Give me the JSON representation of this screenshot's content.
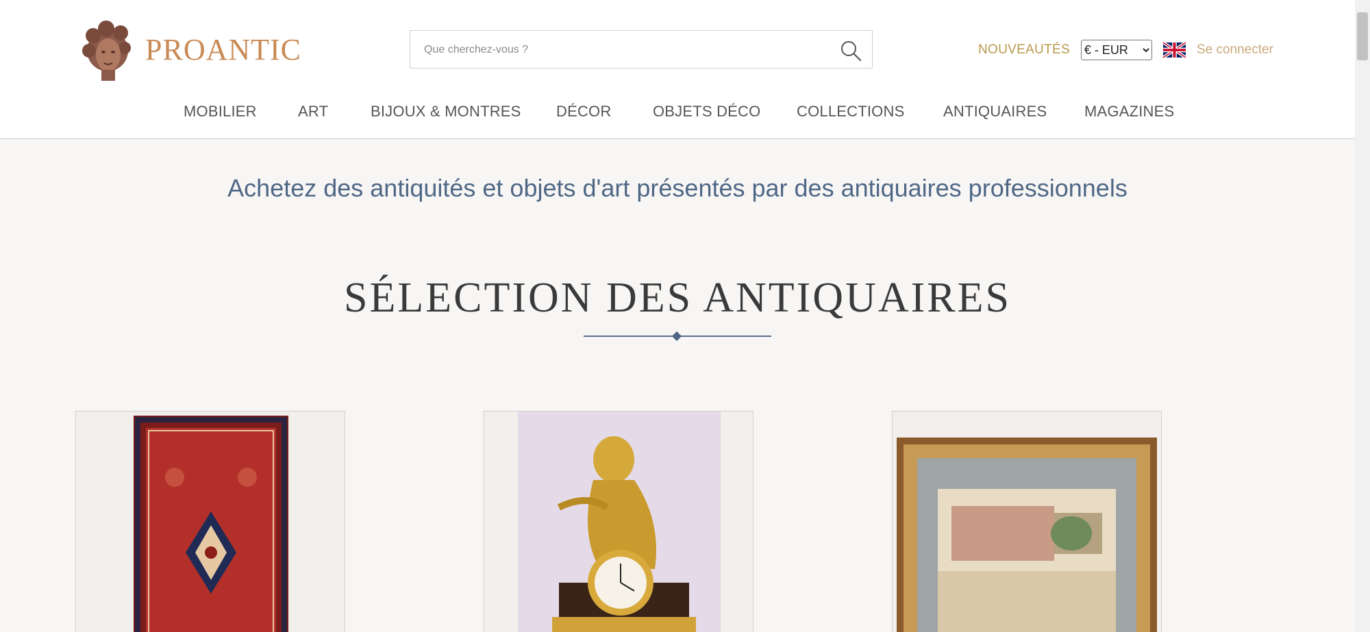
{
  "brand": {
    "name": "PROANTIC",
    "logo_icon": "medusa-head-icon",
    "accent": "#c98a55"
  },
  "search": {
    "placeholder": "Que cherchez-vous ?",
    "value": "",
    "icon": "search-icon"
  },
  "top_right": {
    "new_label": "NOUVEAUTÉS",
    "currency_selected": "€ - EUR",
    "language_flag": "uk-flag-icon",
    "login_label": "Se connecter"
  },
  "nav": {
    "items": [
      {
        "label": "MOBILIER"
      },
      {
        "label": "ART"
      },
      {
        "label": "BIJOUX & MONTRES"
      },
      {
        "label": "DÉCOR"
      },
      {
        "label": "OBJETS DÉCO"
      },
      {
        "label": "COLLECTIONS"
      },
      {
        "label": "ANTIQUAIRES"
      },
      {
        "label": "MAGAZINES"
      }
    ]
  },
  "tagline": "Achetez des antiquités et objets d'art présentés par des antiquaires professionnels",
  "selection": {
    "title": "SÉLECTION DES ANTIQUAIRES",
    "cards": [
      {
        "image": "persian-rug-image"
      },
      {
        "image": "gilt-bronze-clock-image"
      },
      {
        "image": "framed-engraving-image"
      }
    ]
  },
  "colors": {
    "nav_text": "#555555",
    "tagline": "#4f6785",
    "gold_link": "#b9994d",
    "login_link": "#c9a97a"
  }
}
